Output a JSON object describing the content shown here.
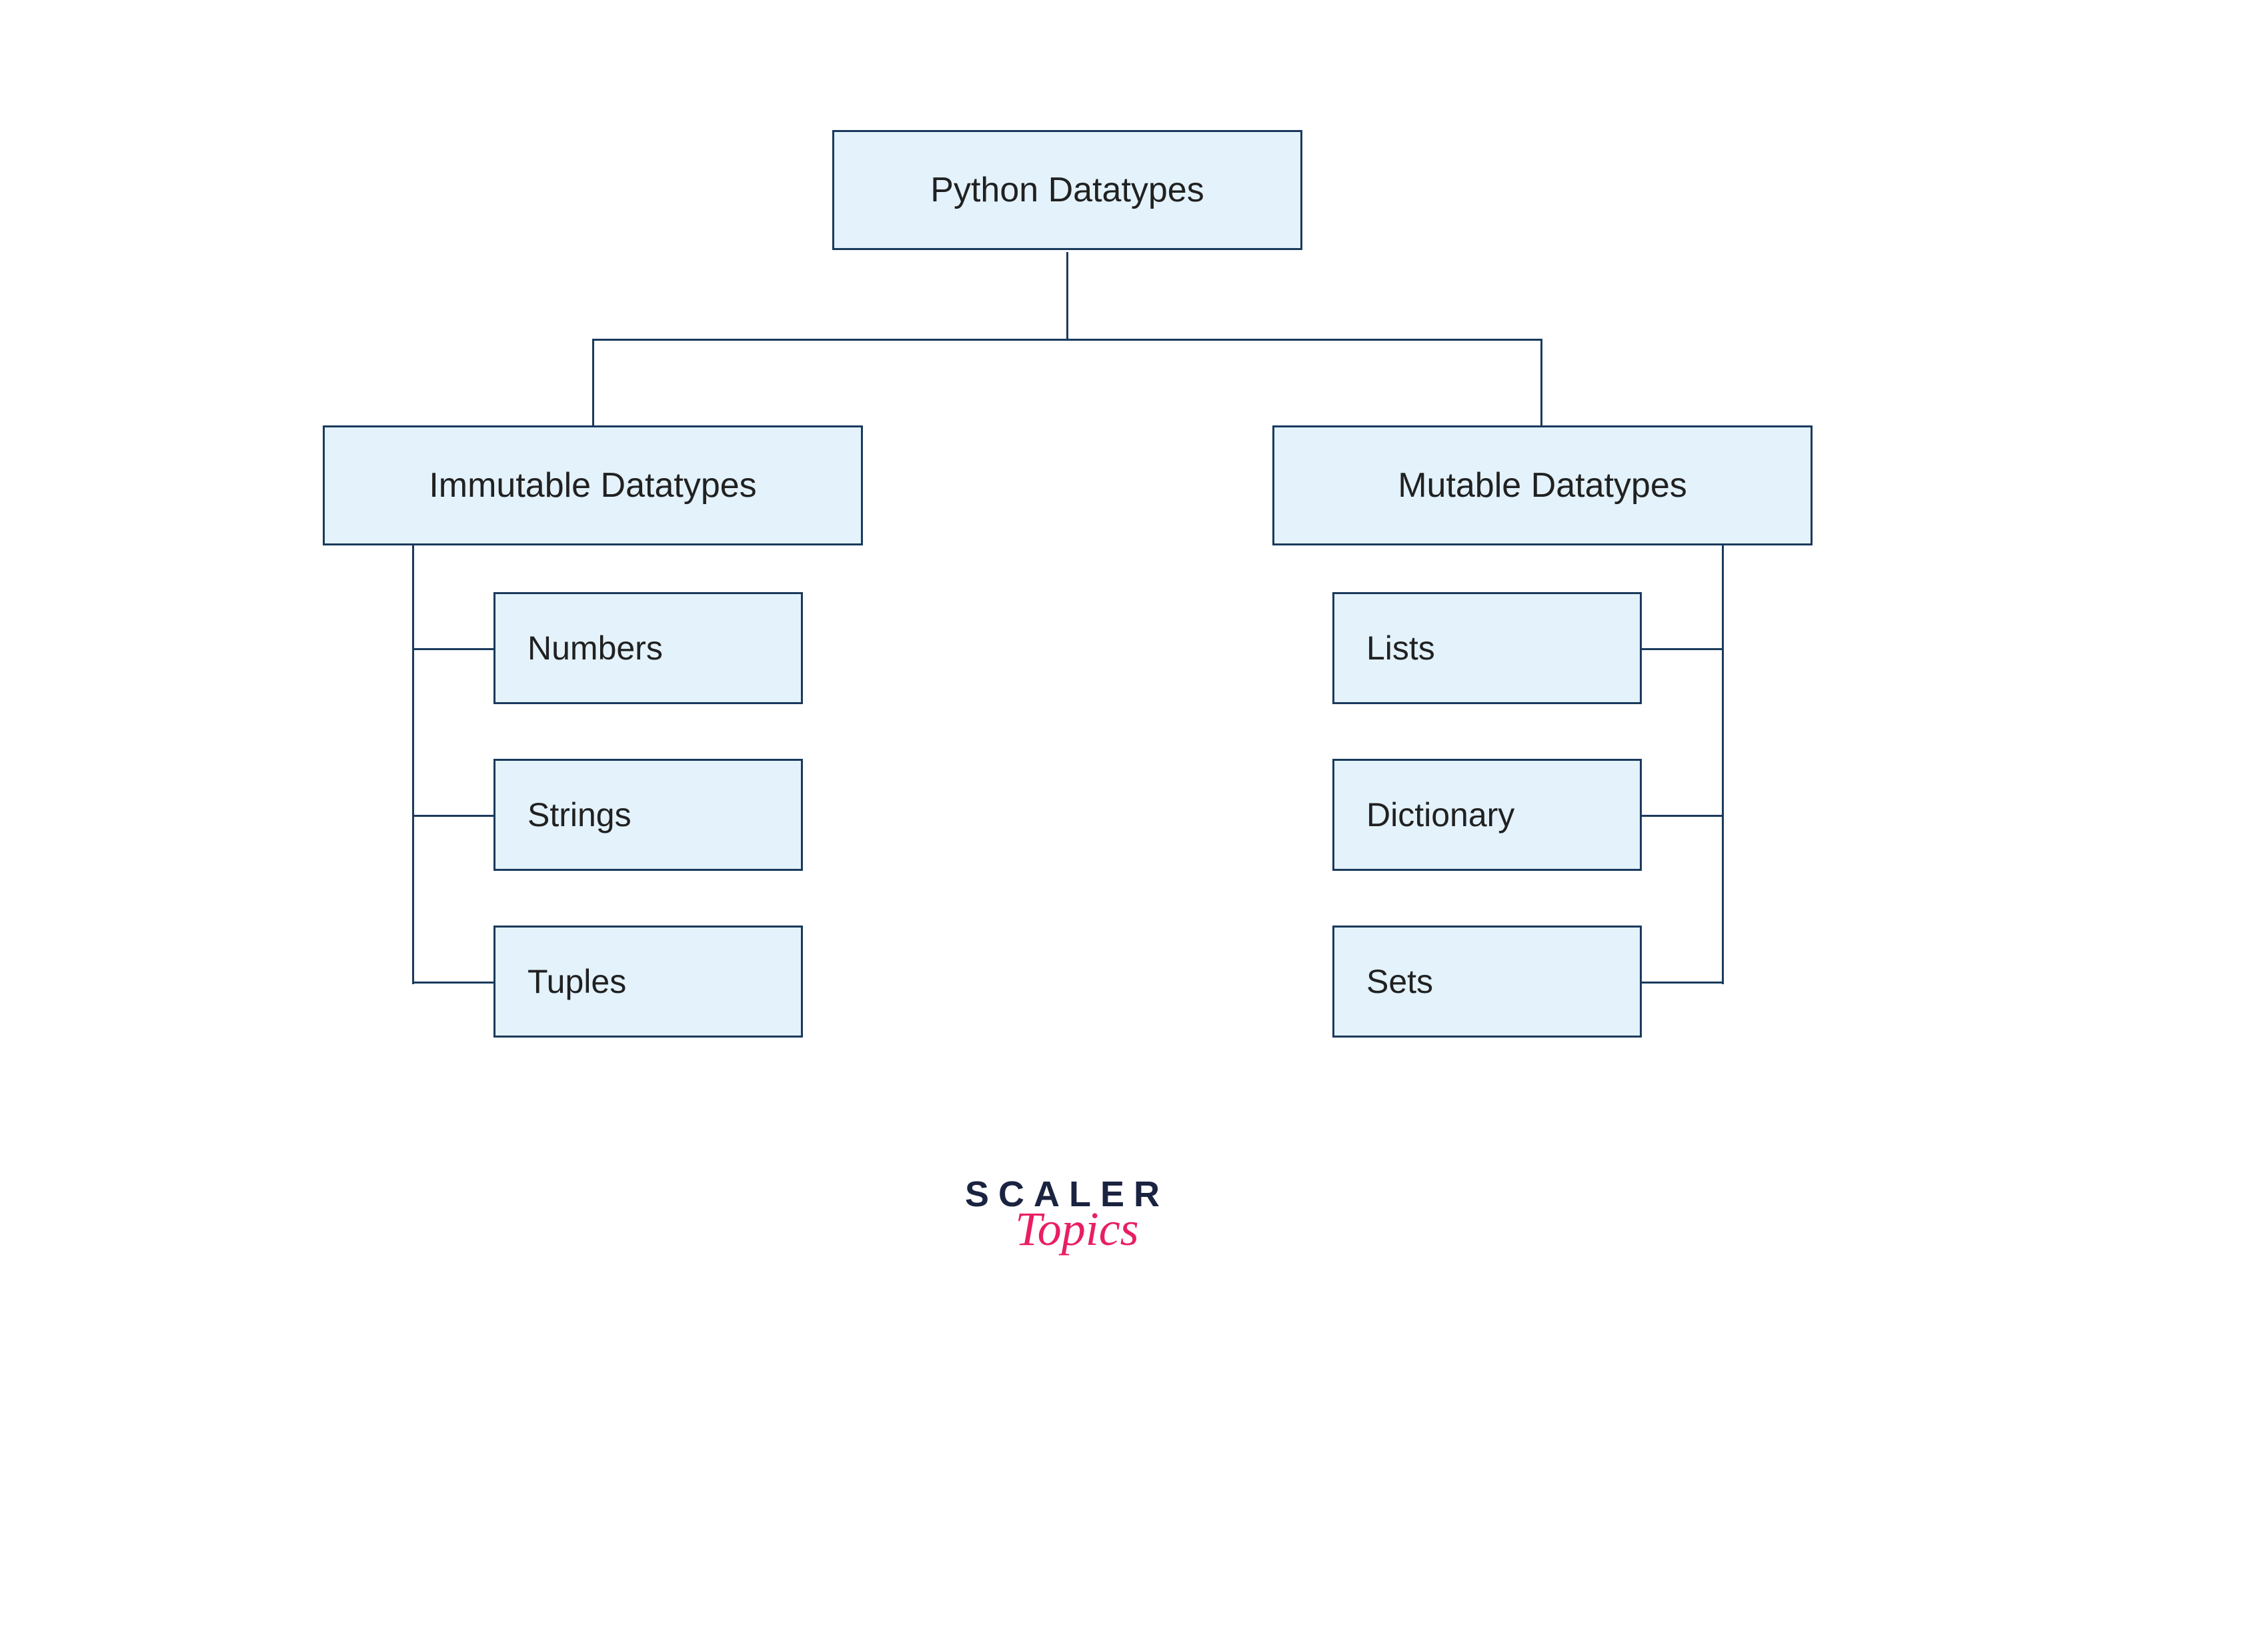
{
  "root": {
    "label": "Python Datatypes"
  },
  "branches": {
    "left": {
      "label": "Immutable Datatypes",
      "children": [
        {
          "label": "Numbers"
        },
        {
          "label": "Strings"
        },
        {
          "label": "Tuples"
        }
      ]
    },
    "right": {
      "label": "Mutable Datatypes",
      "children": [
        {
          "label": "Lists"
        },
        {
          "label": "Dictionary"
        },
        {
          "label": "Sets"
        }
      ]
    }
  },
  "logo": {
    "line1": "SCALER",
    "line2": "Topics"
  },
  "colors": {
    "boxFill": "#e3f2fb",
    "boxBorder": "#1a3a5c",
    "text": "#212121",
    "logoDark": "#1a2340",
    "logoPink": "#e91e63"
  }
}
